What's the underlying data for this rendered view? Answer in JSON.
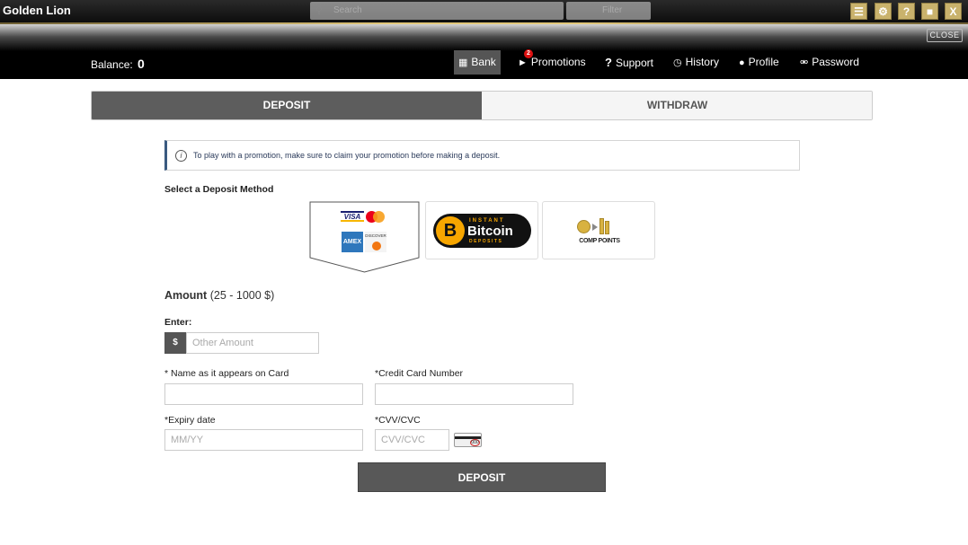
{
  "app": {
    "title": "Golden Lion"
  },
  "topbar": {
    "search_placeholder": "Search",
    "filter_label": "Filter",
    "icons": [
      "coins-icon",
      "gear-icon",
      "help-icon",
      "chat-icon",
      "close-x-icon"
    ],
    "close_x_label": "X",
    "help_label": "?"
  },
  "header": {
    "close_label": "CLOSE",
    "balance_label": "Balance:",
    "balance_value": "0",
    "nav": [
      {
        "label": "Bank",
        "icon": "bank-icon",
        "active": true
      },
      {
        "label": "Promotions",
        "icon": "megaphone-icon",
        "badge": "2"
      },
      {
        "label": "Support",
        "icon": "question-icon"
      },
      {
        "label": "History",
        "icon": "history-icon"
      },
      {
        "label": "Profile",
        "icon": "user-icon"
      },
      {
        "label": "Password",
        "icon": "key-icon"
      }
    ]
  },
  "tabs": {
    "deposit": "DEPOSIT",
    "withdraw": "WITHDRAW",
    "active": "deposit"
  },
  "notice": {
    "text": "To play with a promotion, make sure to claim your promotion before making a deposit."
  },
  "methods": {
    "title": "Select a Deposit Method",
    "items": [
      {
        "name": "credit-cards",
        "brands": [
          "VISA",
          "Mastercard",
          "AMEX",
          "DISCOVER"
        ],
        "selected": true
      },
      {
        "name": "bitcoin",
        "line1": "INSTANT",
        "line2": "Bitcoin",
        "line3": "DEPOSITS"
      },
      {
        "name": "comp-points",
        "label": "COMP POINTS"
      }
    ]
  },
  "form": {
    "amount_title": "Amount",
    "amount_range": "(25 - 1000 $)",
    "enter_label": "Enter:",
    "currency_symbol": "$",
    "amount_placeholder": "Other Amount",
    "name_label": "* Name as it appears on Card",
    "name_value": "",
    "card_number_label": "*Credit Card Number",
    "card_number_value": "",
    "expiry_label": "*Expiry date",
    "expiry_placeholder": "MM/YY",
    "cvv_label": "*CVV/CVC",
    "cvv_placeholder": "CVV/CVC",
    "submit_label": "DEPOSIT"
  }
}
